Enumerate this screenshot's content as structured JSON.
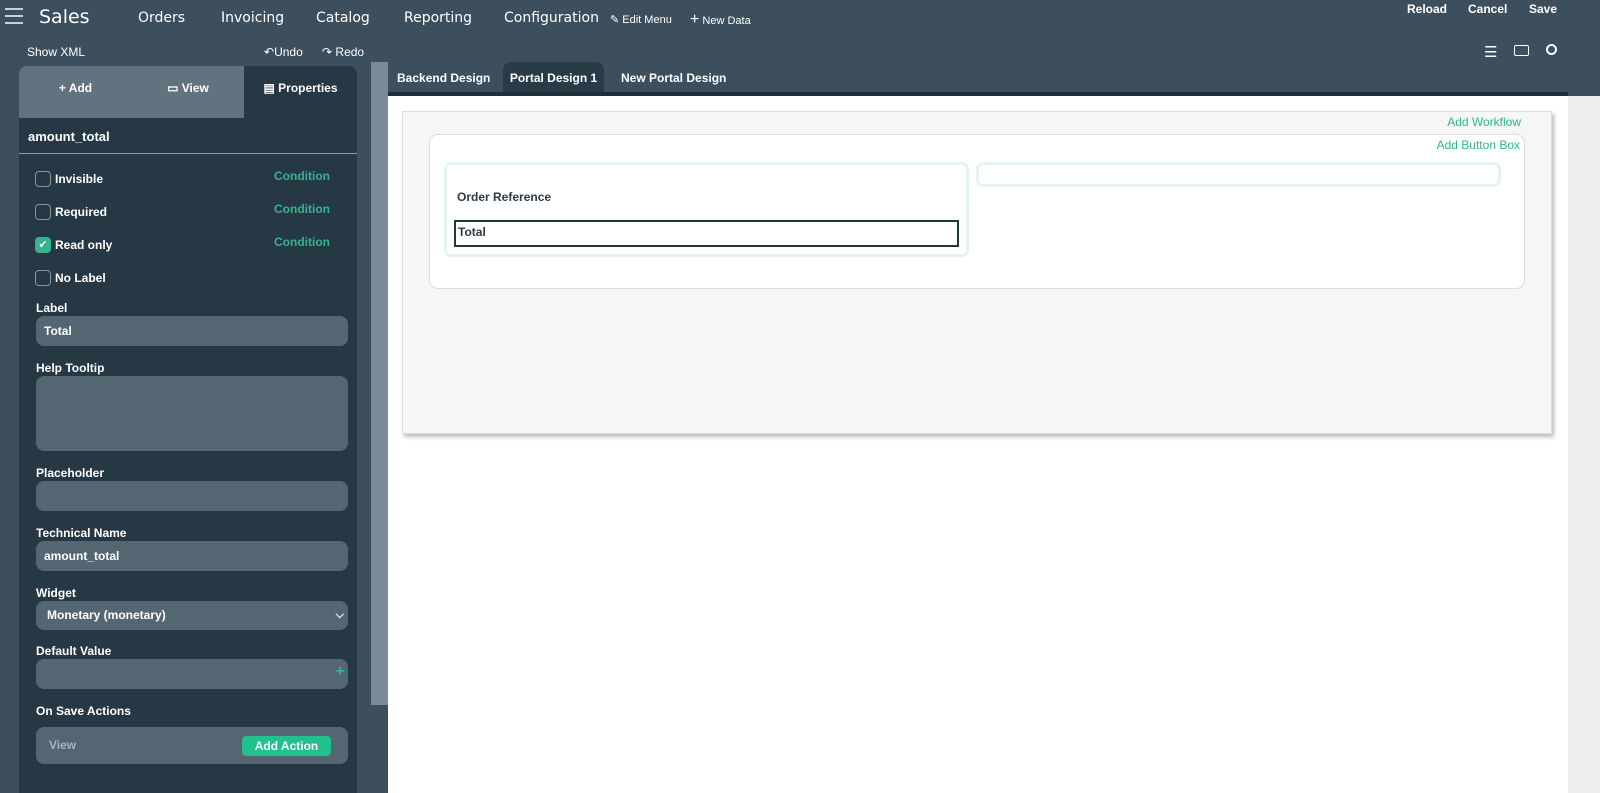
{
  "topbar": {
    "app": "Sales",
    "menu": [
      "Orders",
      "Invoicing",
      "Catalog",
      "Reporting",
      "Configuration"
    ],
    "edit_menu": "Edit Menu",
    "new_data": "New Data",
    "reload": "Reload",
    "cancel": "Cancel",
    "save": "Save"
  },
  "toolbar": {
    "show_xml": "Show XML",
    "undo": "Undo",
    "redo": "Redo"
  },
  "panel": {
    "tabs": {
      "add": "Add",
      "view": "View",
      "properties": "Properties"
    },
    "field_name": "amount_total",
    "checks": [
      {
        "label": "Invisible",
        "checked": false,
        "condition": "Condition"
      },
      {
        "label": "Required",
        "checked": false,
        "condition": "Condition"
      },
      {
        "label": "Read only",
        "checked": true,
        "condition": "Condition"
      },
      {
        "label": "No Label",
        "checked": false
      }
    ],
    "label_title": "Label",
    "label_value": "Total",
    "help_title": "Help Tooltip",
    "placeholder_title": "Placeholder",
    "tech_title": "Technical Name",
    "tech_value": "amount_total",
    "widget_title": "Widget",
    "widget_value": "Monetary (monetary)",
    "default_title": "Default Value",
    "onsave_title": "On Save Actions",
    "onsave_view": "View",
    "add_action": "Add Action"
  },
  "design_tabs": [
    "Backend Design",
    "Portal Design 1",
    "New Portal Design"
  ],
  "canvas": {
    "add_workflow": "Add Workflow",
    "add_button_box": "Add Button Box",
    "order_reference": "Order Reference",
    "total": "Total"
  },
  "colors": {
    "accent": "#35b38f",
    "panel": "#273845",
    "topbar": "#3d4f5c"
  }
}
